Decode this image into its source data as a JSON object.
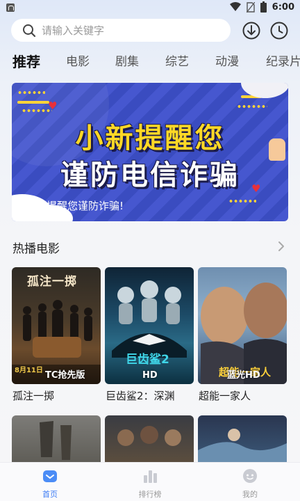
{
  "status_bar": {
    "time": "6:00"
  },
  "search": {
    "placeholder": "请输入关键字"
  },
  "header_icons": {
    "download": "download-icon",
    "history": "clock-icon"
  },
  "tabs": [
    {
      "label": "推荐",
      "active": true
    },
    {
      "label": "电影"
    },
    {
      "label": "剧集"
    },
    {
      "label": "综艺"
    },
    {
      "label": "动漫"
    },
    {
      "label": "纪录片"
    }
  ],
  "banner": {
    "line1": "小新提醒您",
    "line2": "谨防电信诈骗",
    "caption": "小新提醒您谨防诈骗!"
  },
  "section": {
    "title": "热播电影"
  },
  "movies": [
    {
      "title": "孤注一掷",
      "badge": "TC抢先版",
      "date_badge": "8月11日",
      "poster_text": "孤注一掷"
    },
    {
      "title": "巨齿鲨2：深渊",
      "badge": "HD",
      "poster_text": "巨齿鲨2"
    },
    {
      "title": "超能一家人",
      "badge": "蓝光HD",
      "poster_text": "超能一家人"
    }
  ],
  "bottom_nav": [
    {
      "label": "首页",
      "icon": "home-icon",
      "active": true
    },
    {
      "label": "排行榜",
      "icon": "chart-icon"
    },
    {
      "label": "我的",
      "icon": "profile-icon"
    }
  ],
  "colors": {
    "accent": "#3d7cf4",
    "banner_bg": "#3a4cc0",
    "banner_title": "#ffd826"
  }
}
